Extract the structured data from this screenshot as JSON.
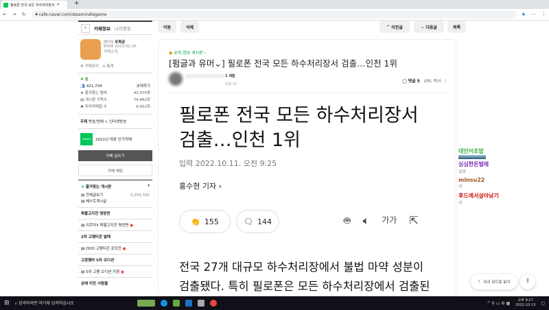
{
  "browser": {
    "tab_title": "필로폰 전국 모든 하수처리장서",
    "url": "cafe.naver.com/steamindiegame"
  },
  "sidebar": {
    "tab_info": "카페정보",
    "tab_activity": "나의활동",
    "manager_badge": "매니저",
    "manager": "우왁굳",
    "since": "since 2015.02.26.",
    "cafe_intro": "카페소개",
    "admin": "카페관리",
    "stats": "통계",
    "level": "숲",
    "members": "421,704",
    "invite": "초대하기",
    "fav_members_label": "즐겨찾는 멤버",
    "fav_members": "43,375명",
    "subscribers_label": "게시판 구독수",
    "subscribers": "74,482회",
    "ally_label": "우리카페앱 수",
    "ally": "6,652회",
    "topic_label": "주제",
    "topic": "방송/연예 > 인터넷방송",
    "award": "2021년 대표 인기카페",
    "write": "카페 글쓰기",
    "chat": "카페 채팅",
    "fav_boards": "즐겨찾는 게시판",
    "boards": [
      {
        "t": "전체글보기",
        "n": "5,250,325"
      },
      {
        "t": "베스트게시글",
        "n": ""
      }
    ],
    "sections": [
      {
        "h": "왁물고지전 명장면",
        "item": "이르마3 왁물고지전 명장면"
      },
      {
        "h": "2차 고멤티콘 발매",
        "item": "OOO 고멤티콘 공모전"
      },
      {
        "h": "고정멤버 5차 오디션",
        "item": "5차 고멤 오디션 지원"
      },
      {
        "h": "굳에 미친 사람들",
        "item": ""
      }
    ]
  },
  "toolbar": {
    "move": "이동",
    "delete": "삭제",
    "prev": "이전글",
    "next": "다음글",
    "list": "목록"
  },
  "article": {
    "board": "유머,정보 게시판",
    "title": "[펌글과 유머⌄] 필로폰 전국 모든 하수처리장서 검출…인천 1위",
    "author_suffix": "1 세달",
    "views": "조회 25",
    "comments": "댓글 5",
    "url_copy": "URL 복사",
    "headline": "필로폰 전국 모든 하수처리장서 검출…인천 1위",
    "date": "입력 2022.10.11. 오전 9:25",
    "reporter": "홍수현 기자",
    "reactions": "155",
    "comment_count": "144",
    "font_btn": "가가",
    "body": "전국 27개 대규모 하수처리장에서 불법 마약 성분이 검출됐다. 특히 필로폰은 모든 하수처리장에서 검출된 것"
  },
  "chat": [
    {
      "name": "대인어초밥",
      "msg": "",
      "color": "#3cb043"
    },
    {
      "name": "심심한돈벌레",
      "msg": "일쌍",
      "color": "#7b2fb5"
    },
    {
      "name": "minsu22",
      "msg": "카",
      "color": "#a0521d"
    },
    {
      "name": "후드에서살아남기",
      "msg": "카",
      "color": "#d01010"
    }
  ],
  "darkmode": "다크 모드로 보기",
  "taskbar": {
    "search": "검색하려면 여기에 입력하십시오",
    "time": "오후 9:27",
    "date": "2022-10-13"
  }
}
